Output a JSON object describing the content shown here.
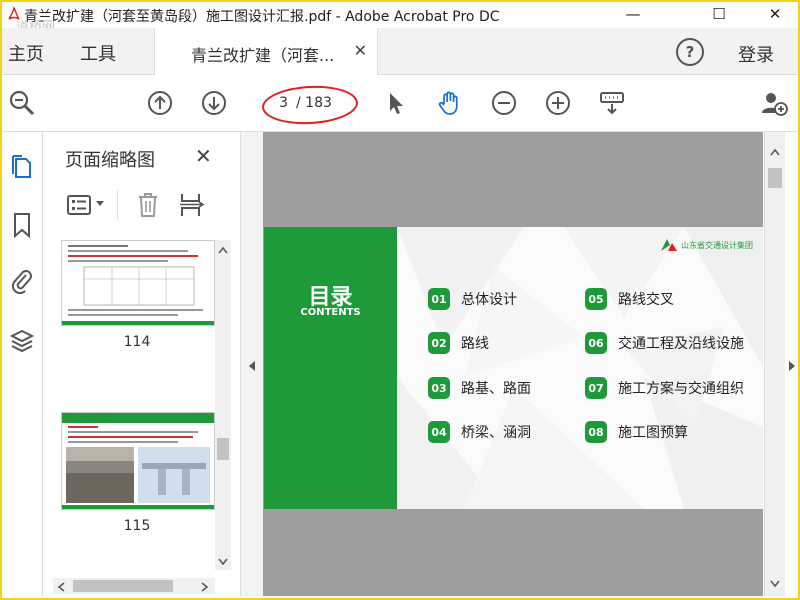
{
  "window": {
    "title": "青兰改扩建（河套至黄岛段）施工图设计汇报.pdf - Adobe Acrobat Pro DC",
    "watermark": "道桥网",
    "minimize": "—",
    "maximize": "☐",
    "close": "✕"
  },
  "tabs": {
    "home": "主页",
    "tools": "工具",
    "document": "青兰改扩建（河套...",
    "document_close": "✕",
    "help": "?",
    "login": "登录"
  },
  "toolbar": {
    "current_page": "3",
    "total_pages": "/ 183"
  },
  "thumbnail_panel": {
    "title": "页面缩略图",
    "close": "✕",
    "thumbnails": [
      {
        "page_label": "114"
      },
      {
        "page_label": "115",
        "header_text": "路基、路面"
      }
    ]
  },
  "slide": {
    "heading": "目录",
    "subheading": "CONTENTS",
    "logo_text": "山东省交通设计集团",
    "toc": [
      {
        "num": "01",
        "label": "总体设计"
      },
      {
        "num": "02",
        "label": "路线"
      },
      {
        "num": "03",
        "label": "路基、路面"
      },
      {
        "num": "04",
        "label": "桥梁、涵洞"
      },
      {
        "num": "05",
        "label": "路线交叉"
      },
      {
        "num": "06",
        "label": "交通工程及沿线设施"
      },
      {
        "num": "07",
        "label": "施工方案与交通组织"
      },
      {
        "num": "08",
        "label": "施工图预算"
      }
    ]
  },
  "colors": {
    "accent_green": "#1f9a3b",
    "annotation_red": "#e0201c",
    "hand_tool_blue": "#1a6fd1",
    "frame_yellow": "#f2d21a"
  }
}
